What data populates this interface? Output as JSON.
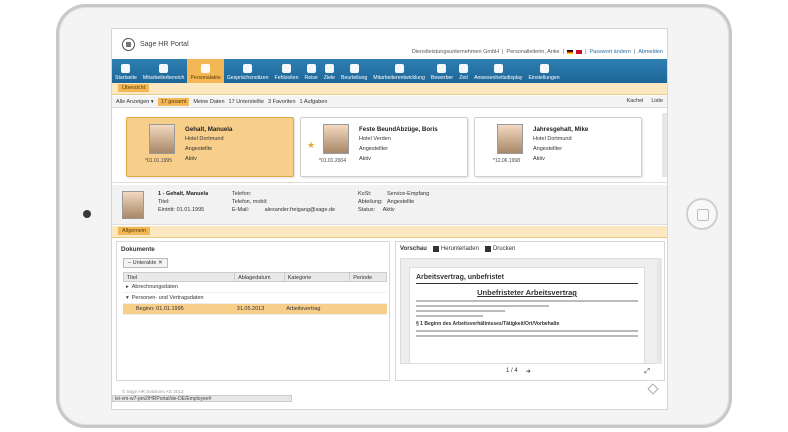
{
  "header": {
    "app_title": "Sage HR Portal",
    "company": "Dienstleistungsunternehmen GmbH",
    "user": "Personalleiterin, Anke",
    "change_password": "Passwort ändern",
    "logout": "Abmelden"
  },
  "nav": [
    {
      "label": "Startseite",
      "icon": "home-icon"
    },
    {
      "label": "Mitarbeiterbereich",
      "icon": "person-icon"
    },
    {
      "label": "Personalakte",
      "icon": "file-person-icon"
    },
    {
      "label": "Gesprächsnotizen",
      "icon": "notes-icon"
    },
    {
      "label": "Fehlzeiten",
      "icon": "calendar-icon"
    },
    {
      "label": "Reise",
      "icon": "plane-icon"
    },
    {
      "label": "Ziele",
      "icon": "flag-icon"
    },
    {
      "label": "Beurteilung",
      "icon": "rating-icon"
    },
    {
      "label": "Mitarbeiterentwicklung",
      "icon": "growth-icon"
    },
    {
      "label": "Bewerber",
      "icon": "applicant-icon"
    },
    {
      "label": "Zeit",
      "icon": "clock-icon"
    },
    {
      "label": "Anwesenheitsdisplay",
      "icon": "display-icon"
    },
    {
      "label": "Einstellungen",
      "icon": "wrench-icon"
    }
  ],
  "tabs": {
    "overview": "Übersicht",
    "general": "Allgemein"
  },
  "filter": {
    "all_label": "Alle Anzeigen",
    "total_count": "17",
    "total_label": "gesamt",
    "mine_label": "Meine Daten",
    "sub_count": "17",
    "sub_label": "Unterstellte",
    "fav_count": "3",
    "fav_label": "Favoriten",
    "tasks_count": "1",
    "tasks_label": "Aufgaben",
    "view_tiles": "Kachel",
    "view_list": "Liste"
  },
  "cards": [
    {
      "name": "Gehalt, Manuela",
      "location": "Hotel Dortmund",
      "role": "Angestellte",
      "status": "Aktiv",
      "date": "*01.01.1995",
      "selected": true,
      "favorite": false
    },
    {
      "name": "Feste BeundAbzüge, Boris",
      "location": "Hotel Verden",
      "role": "Angestellter",
      "status": "Aktiv",
      "date": "*01.01.2004",
      "selected": false,
      "favorite": true
    },
    {
      "name": "Jahresgehalt, Mike",
      "location": "Hotel Dortmund",
      "role": "Angestellter",
      "status": "Aktiv",
      "date": "*12.06.1998",
      "selected": false,
      "favorite": false
    }
  ],
  "detail": {
    "name_line": "1 - Gehalt, Manuela",
    "title_label": "Titel:",
    "entry_label": "Eintritt:",
    "entry_value": "01.01.1995",
    "phone_label": "Telefon:",
    "mobile_label": "Telefon, mobil:",
    "email_label": "E-Mail:",
    "email_value": "alexander.freigang@sage.de",
    "cost_label": "KoSt:",
    "cost_value": "Service-Empfang",
    "dept_label": "Abteilung:",
    "dept_value": "Angestellte",
    "status_label": "Status:",
    "status_value": "Aktiv"
  },
  "documents": {
    "title": "Dokumente",
    "filter_chip": "Unterakte",
    "columns": [
      "Titel",
      "Ablagedatum",
      "Kategorie",
      "Periode"
    ],
    "groups": [
      "Abrechnungsdaten",
      "Personen- und Vertragsdaten"
    ],
    "row": {
      "title": "Beginn: 01.01.1995",
      "date": "31.05.2013",
      "category": "Arbeitsvertrag",
      "period": ""
    }
  },
  "preview": {
    "title": "Vorschau",
    "download": "Herunterladen",
    "print": "Drucken",
    "doc_heading": "Arbeitsvertrag, unbefristet",
    "doc_title": "Unbefristeter Arbeitsvertrag",
    "section": "§ 1 Beginn des Arbeitsverhältnisses/Tätigkeit/Ort/Vorbehalte",
    "page": "1 / 4"
  },
  "footer": {
    "copyright": "© Sage HR Solutions AG 2013",
    "url": "lei-vm-w7-pm2/HRPortal/de-DE/Employee#"
  }
}
